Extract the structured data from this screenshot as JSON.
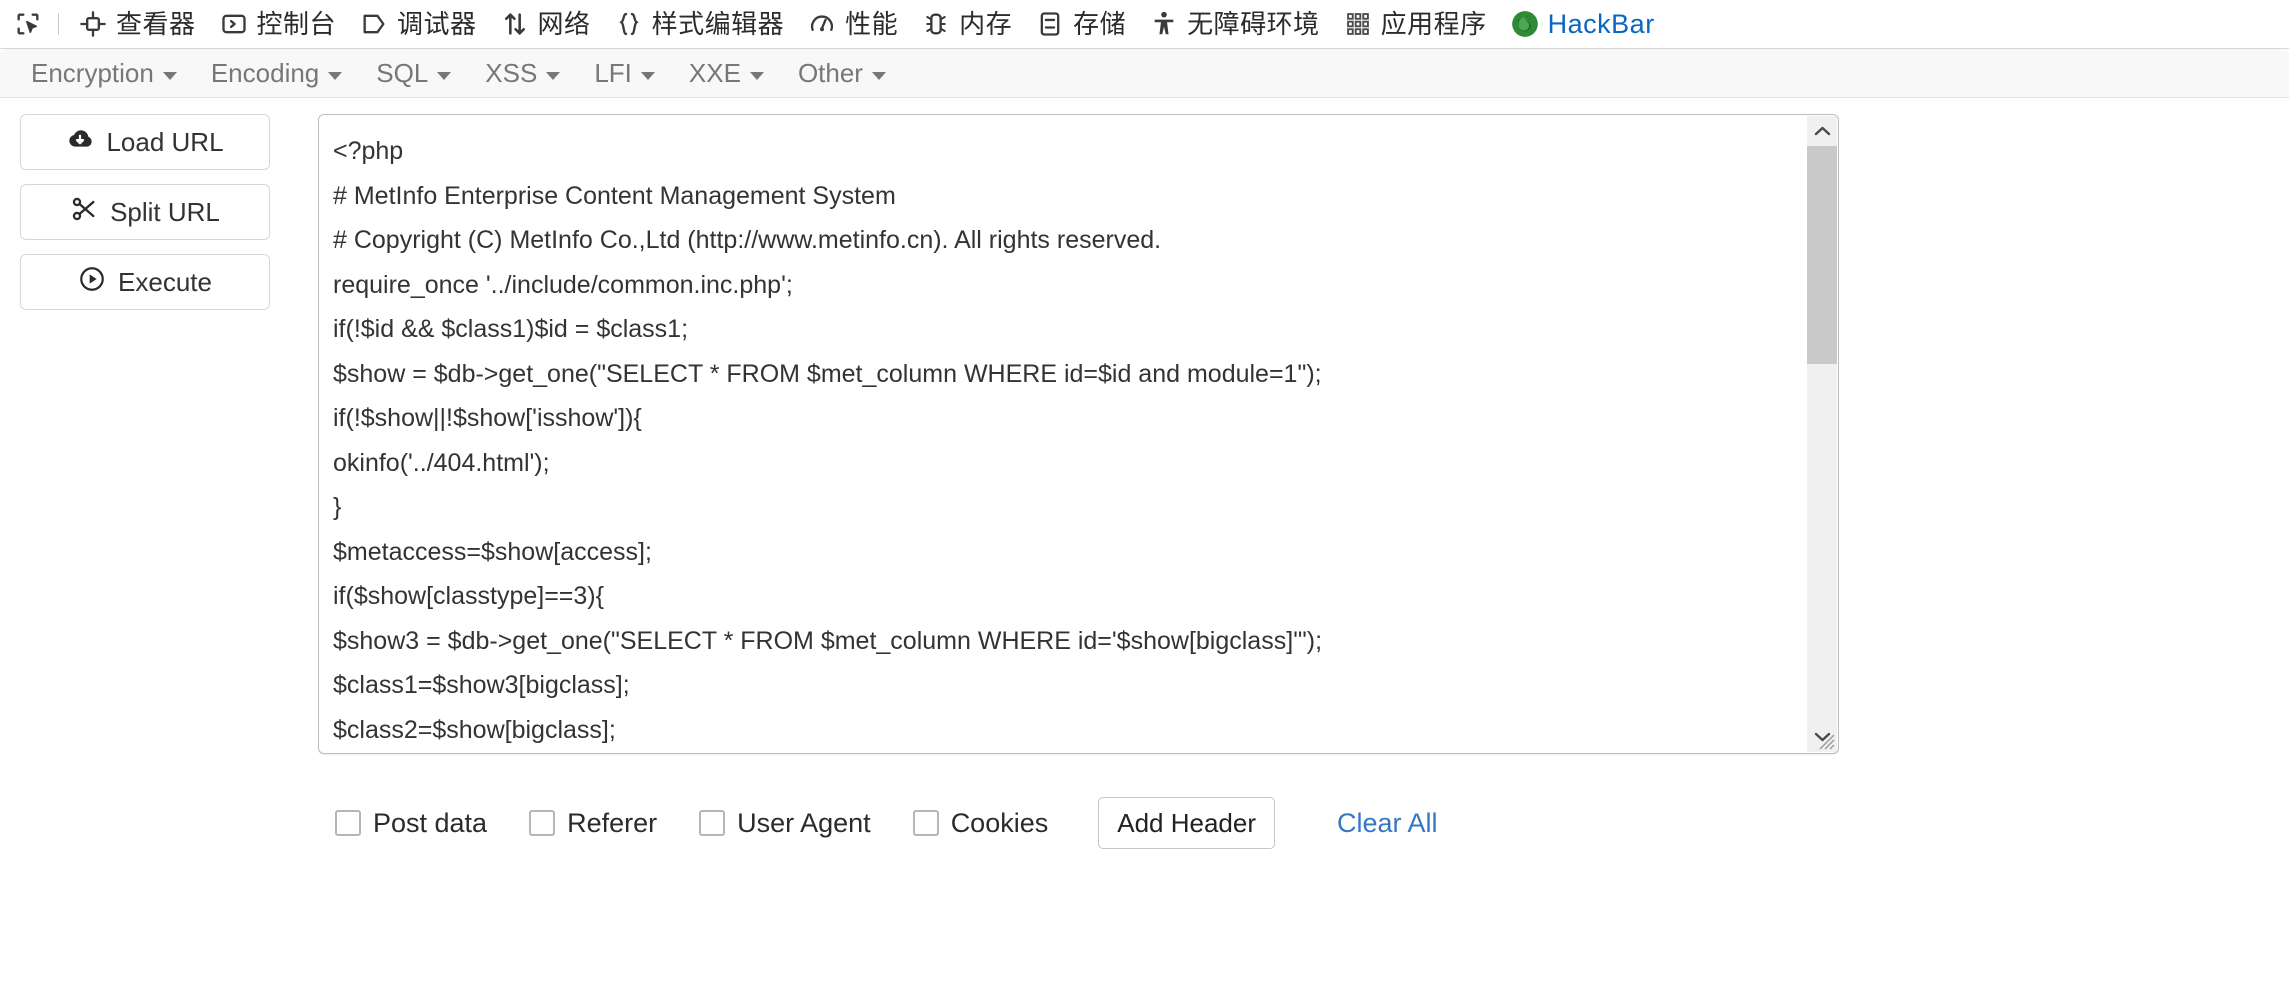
{
  "devtools": {
    "picker_icon": "element-picker-icon",
    "tabs": [
      {
        "label": "查看器",
        "icon": "inspector-icon"
      },
      {
        "label": "控制台",
        "icon": "console-icon"
      },
      {
        "label": "调试器",
        "icon": "debugger-icon"
      },
      {
        "label": "网络",
        "icon": "network-icon"
      },
      {
        "label": "样式编辑器",
        "icon": "style-editor-icon"
      },
      {
        "label": "性能",
        "icon": "performance-icon"
      },
      {
        "label": "内存",
        "icon": "memory-icon"
      },
      {
        "label": "存储",
        "icon": "storage-icon"
      },
      {
        "label": "无障碍环境",
        "icon": "accessibility-icon"
      },
      {
        "label": "应用程序",
        "icon": "application-icon"
      },
      {
        "label": "HackBar",
        "icon": "firefox-icon"
      }
    ],
    "active_tab": "HackBar",
    "hackbar_color": "#0a66c2"
  },
  "hackbar": {
    "menus": [
      {
        "label": "Encryption"
      },
      {
        "label": "Encoding"
      },
      {
        "label": "SQL"
      },
      {
        "label": "XSS"
      },
      {
        "label": "LFI"
      },
      {
        "label": "XXE"
      },
      {
        "label": "Other"
      }
    ],
    "sidebar": [
      {
        "label": "Load URL",
        "icon": "cloud-download-icon"
      },
      {
        "label": "Split URL",
        "icon": "scissors-icon"
      },
      {
        "label": "Execute",
        "icon": "play-circle-icon"
      }
    ],
    "editor": {
      "value": "<?php\n# MetInfo Enterprise Content Management System\n# Copyright (C) MetInfo Co.,Ltd (http://www.metinfo.cn). All rights reserved.\nrequire_once '../include/common.inc.php';\nif(!$id && $class1)$id = $class1;\n$show = $db->get_one(\"SELECT * FROM $met_column WHERE id=$id and module=1\");\nif(!$show||!$show['isshow']){\nokinfo('../404.html');\n}\n$metaccess=$show[access];\nif($show[classtype]==3){\n$show3 = $db->get_one(\"SELECT * FROM $met_column WHERE id='$show[bigclass]'\");\n$class1=$show3[bigclass];\n$class2=$show[bigclass];",
      "scrollbar": {
        "up_icon": "chevron-up-icon",
        "down_icon": "chevron-down-icon",
        "thumb_position_percent": 5,
        "thumb_size_percent": 38
      },
      "resize_handle": "resize-grip-icon"
    },
    "controls": {
      "checkboxes": [
        {
          "label": "Post data",
          "checked": false
        },
        {
          "label": "Referer",
          "checked": false
        },
        {
          "label": "User Agent",
          "checked": false
        },
        {
          "label": "Cookies",
          "checked": false
        }
      ],
      "add_header_label": "Add Header",
      "clear_all_label": "Clear All",
      "link_color": "#3677c4"
    }
  }
}
